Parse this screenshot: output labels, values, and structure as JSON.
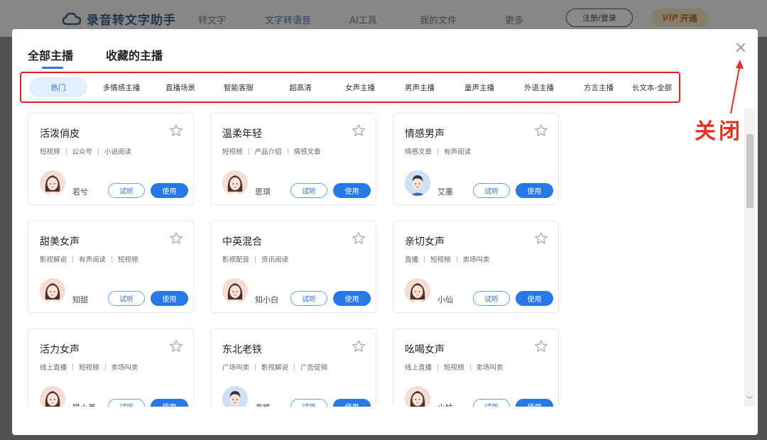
{
  "app": {
    "logo_text": "录音转文字助手",
    "nav": [
      "转文字",
      "文字转语音",
      "AI工具",
      "我的文件",
      "更多"
    ],
    "active_nav": "文字转语音",
    "login_label": "注册/登录",
    "vip_label": "VIP",
    "vip_open": "开通",
    "bottom_hint": "• ·"
  },
  "modal": {
    "tabs": [
      "全部主播",
      "收藏的主播"
    ],
    "active_tab": "全部主播",
    "categories": [
      "热门",
      "多情感主播",
      "直播场景",
      "智能客服",
      "超高清",
      "女声主播",
      "男声主播",
      "童声主播",
      "外语主播",
      "方言主播",
      "长文本-全部"
    ],
    "active_category": "热门",
    "listen_label": "试听",
    "use_label": "使用",
    "cards": [
      {
        "title": "活泼俏皮",
        "tags": [
          "短视频",
          "公众号",
          "小说阅读"
        ],
        "voice": "若兮",
        "avatar": "female"
      },
      {
        "title": "温柔年轻",
        "tags": [
          "短视频",
          "产品介绍",
          "情感文章"
        ],
        "voice": "思琪",
        "avatar": "female"
      },
      {
        "title": "情感男声",
        "tags": [
          "情感文章",
          "有声阅读"
        ],
        "voice": "艾墨",
        "avatar": "male"
      },
      {
        "title": "甜美女声",
        "tags": [
          "影视解说",
          "有声阅读",
          "短视频"
        ],
        "voice": "知甜",
        "avatar": "female"
      },
      {
        "title": "中英混合",
        "tags": [
          "影视配音",
          "资讯阅读"
        ],
        "voice": "知小白",
        "avatar": "female"
      },
      {
        "title": "亲切女声",
        "tags": [
          "直播",
          "短视频",
          "卖场叫卖"
        ],
        "voice": "小仙",
        "avatar": "female"
      },
      {
        "title": "活力女声",
        "tags": [
          "线上直播",
          "短视频",
          "卖场叫卖"
        ],
        "voice": "猫小美",
        "avatar": "female"
      },
      {
        "title": "东北老铁",
        "tags": [
          "广场叫卖",
          "影视解说",
          "广告促销"
        ],
        "voice": "老铁",
        "avatar": "male"
      },
      {
        "title": "吆喝女声",
        "tags": [
          "线上直播",
          "短视频",
          "卖场叫卖"
        ],
        "voice": "小姑",
        "avatar": "female"
      }
    ]
  },
  "annotation": {
    "label": "关闭"
  },
  "colors": {
    "accent": "#2878e6",
    "highlight_border": "#e02020",
    "annotation": "#e53020"
  },
  "icons": {
    "close": "close-icon",
    "star": "star-outline-icon",
    "logo": "cloud-icon"
  }
}
